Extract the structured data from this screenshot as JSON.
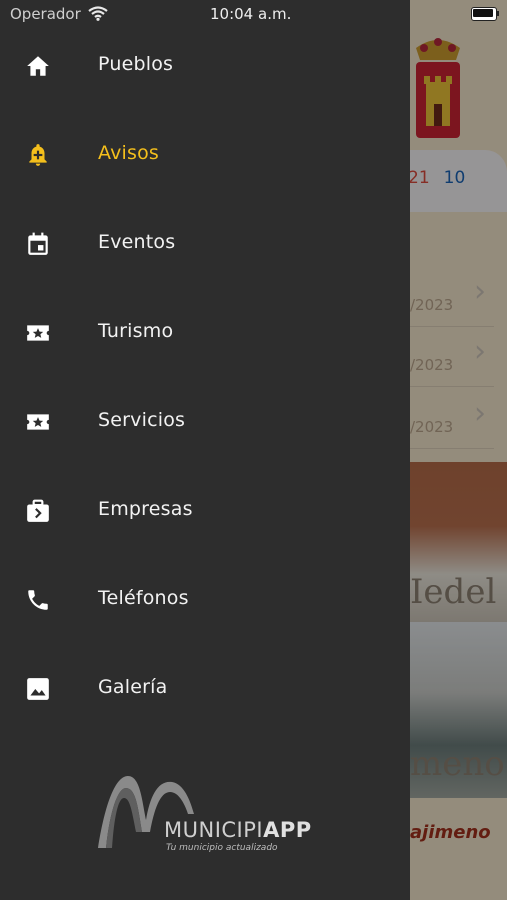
{
  "status_bar": {
    "carrier": "Operador",
    "time": "10:04 a.m."
  },
  "menu": {
    "items": [
      {
        "label": "Pueblos",
        "icon": "home-icon",
        "active": false
      },
      {
        "label": "Avisos",
        "icon": "bell-plus-icon",
        "active": true
      },
      {
        "label": "Eventos",
        "icon": "calendar-icon",
        "active": false
      },
      {
        "label": "Turismo",
        "icon": "ticket-star-icon",
        "active": false
      },
      {
        "label": "Servicios",
        "icon": "ticket-star-icon",
        "active": false
      },
      {
        "label": "Empresas",
        "icon": "briefcase-icon",
        "active": false
      },
      {
        "label": "Teléfonos",
        "icon": "phone-icon",
        "active": false
      },
      {
        "label": "Galería",
        "icon": "image-icon",
        "active": false
      }
    ],
    "active_color": "#f4bf1c"
  },
  "logo": {
    "name_light": "MUNICIPI",
    "name_bold": "APP",
    "tagline": "Tu municipio actualizado"
  },
  "background": {
    "counts": [
      "21",
      "10"
    ],
    "notices": [
      {
        "date": "/2023"
      },
      {
        "date": "/2023"
      },
      {
        "date": "/2023"
      }
    ],
    "image_labels": [
      "Iedel",
      "meno"
    ],
    "town_name": "ajimeno"
  }
}
